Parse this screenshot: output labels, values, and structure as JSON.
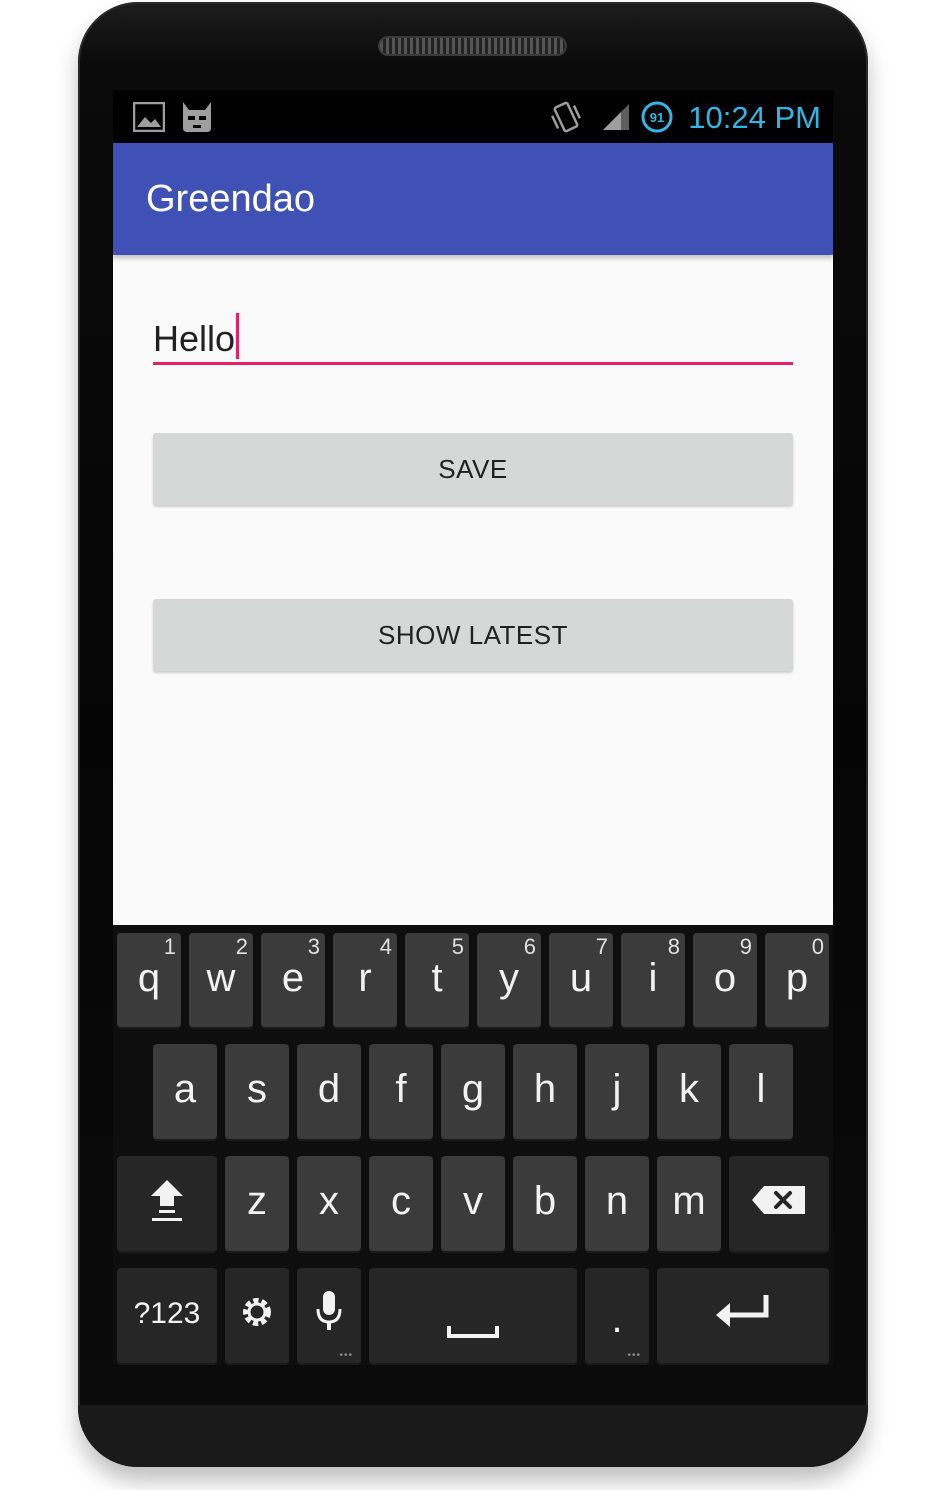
{
  "status_bar": {
    "time": "10:24 PM",
    "battery_level": "91",
    "icons": [
      "gallery-icon",
      "cyanogen-icon",
      "vibrate-icon",
      "signal-icon",
      "battery-icon"
    ],
    "accent_color": "#33b5e5"
  },
  "app_bar": {
    "title": "Greendao",
    "color": "#3f51b5"
  },
  "form": {
    "input_value": "Hello",
    "accent_color": "#e91e63",
    "save_label": "SAVE",
    "show_latest_label": "SHOW LATEST"
  },
  "keyboard": {
    "row1": [
      {
        "key": "q",
        "hint": "1"
      },
      {
        "key": "w",
        "hint": "2"
      },
      {
        "key": "e",
        "hint": "3"
      },
      {
        "key": "r",
        "hint": "4"
      },
      {
        "key": "t",
        "hint": "5"
      },
      {
        "key": "y",
        "hint": "6"
      },
      {
        "key": "u",
        "hint": "7"
      },
      {
        "key": "i",
        "hint": "8"
      },
      {
        "key": "o",
        "hint": "9"
      },
      {
        "key": "p",
        "hint": "0"
      }
    ],
    "row2": [
      "a",
      "s",
      "d",
      "f",
      "g",
      "h",
      "j",
      "k",
      "l"
    ],
    "row3": [
      "z",
      "x",
      "c",
      "v",
      "b",
      "n",
      "m"
    ],
    "symbols_label": "?123",
    "period_label": ".",
    "special_icons": [
      "shift-icon",
      "backspace-icon",
      "settings-icon",
      "microphone-icon",
      "space-icon",
      "enter-icon"
    ]
  }
}
